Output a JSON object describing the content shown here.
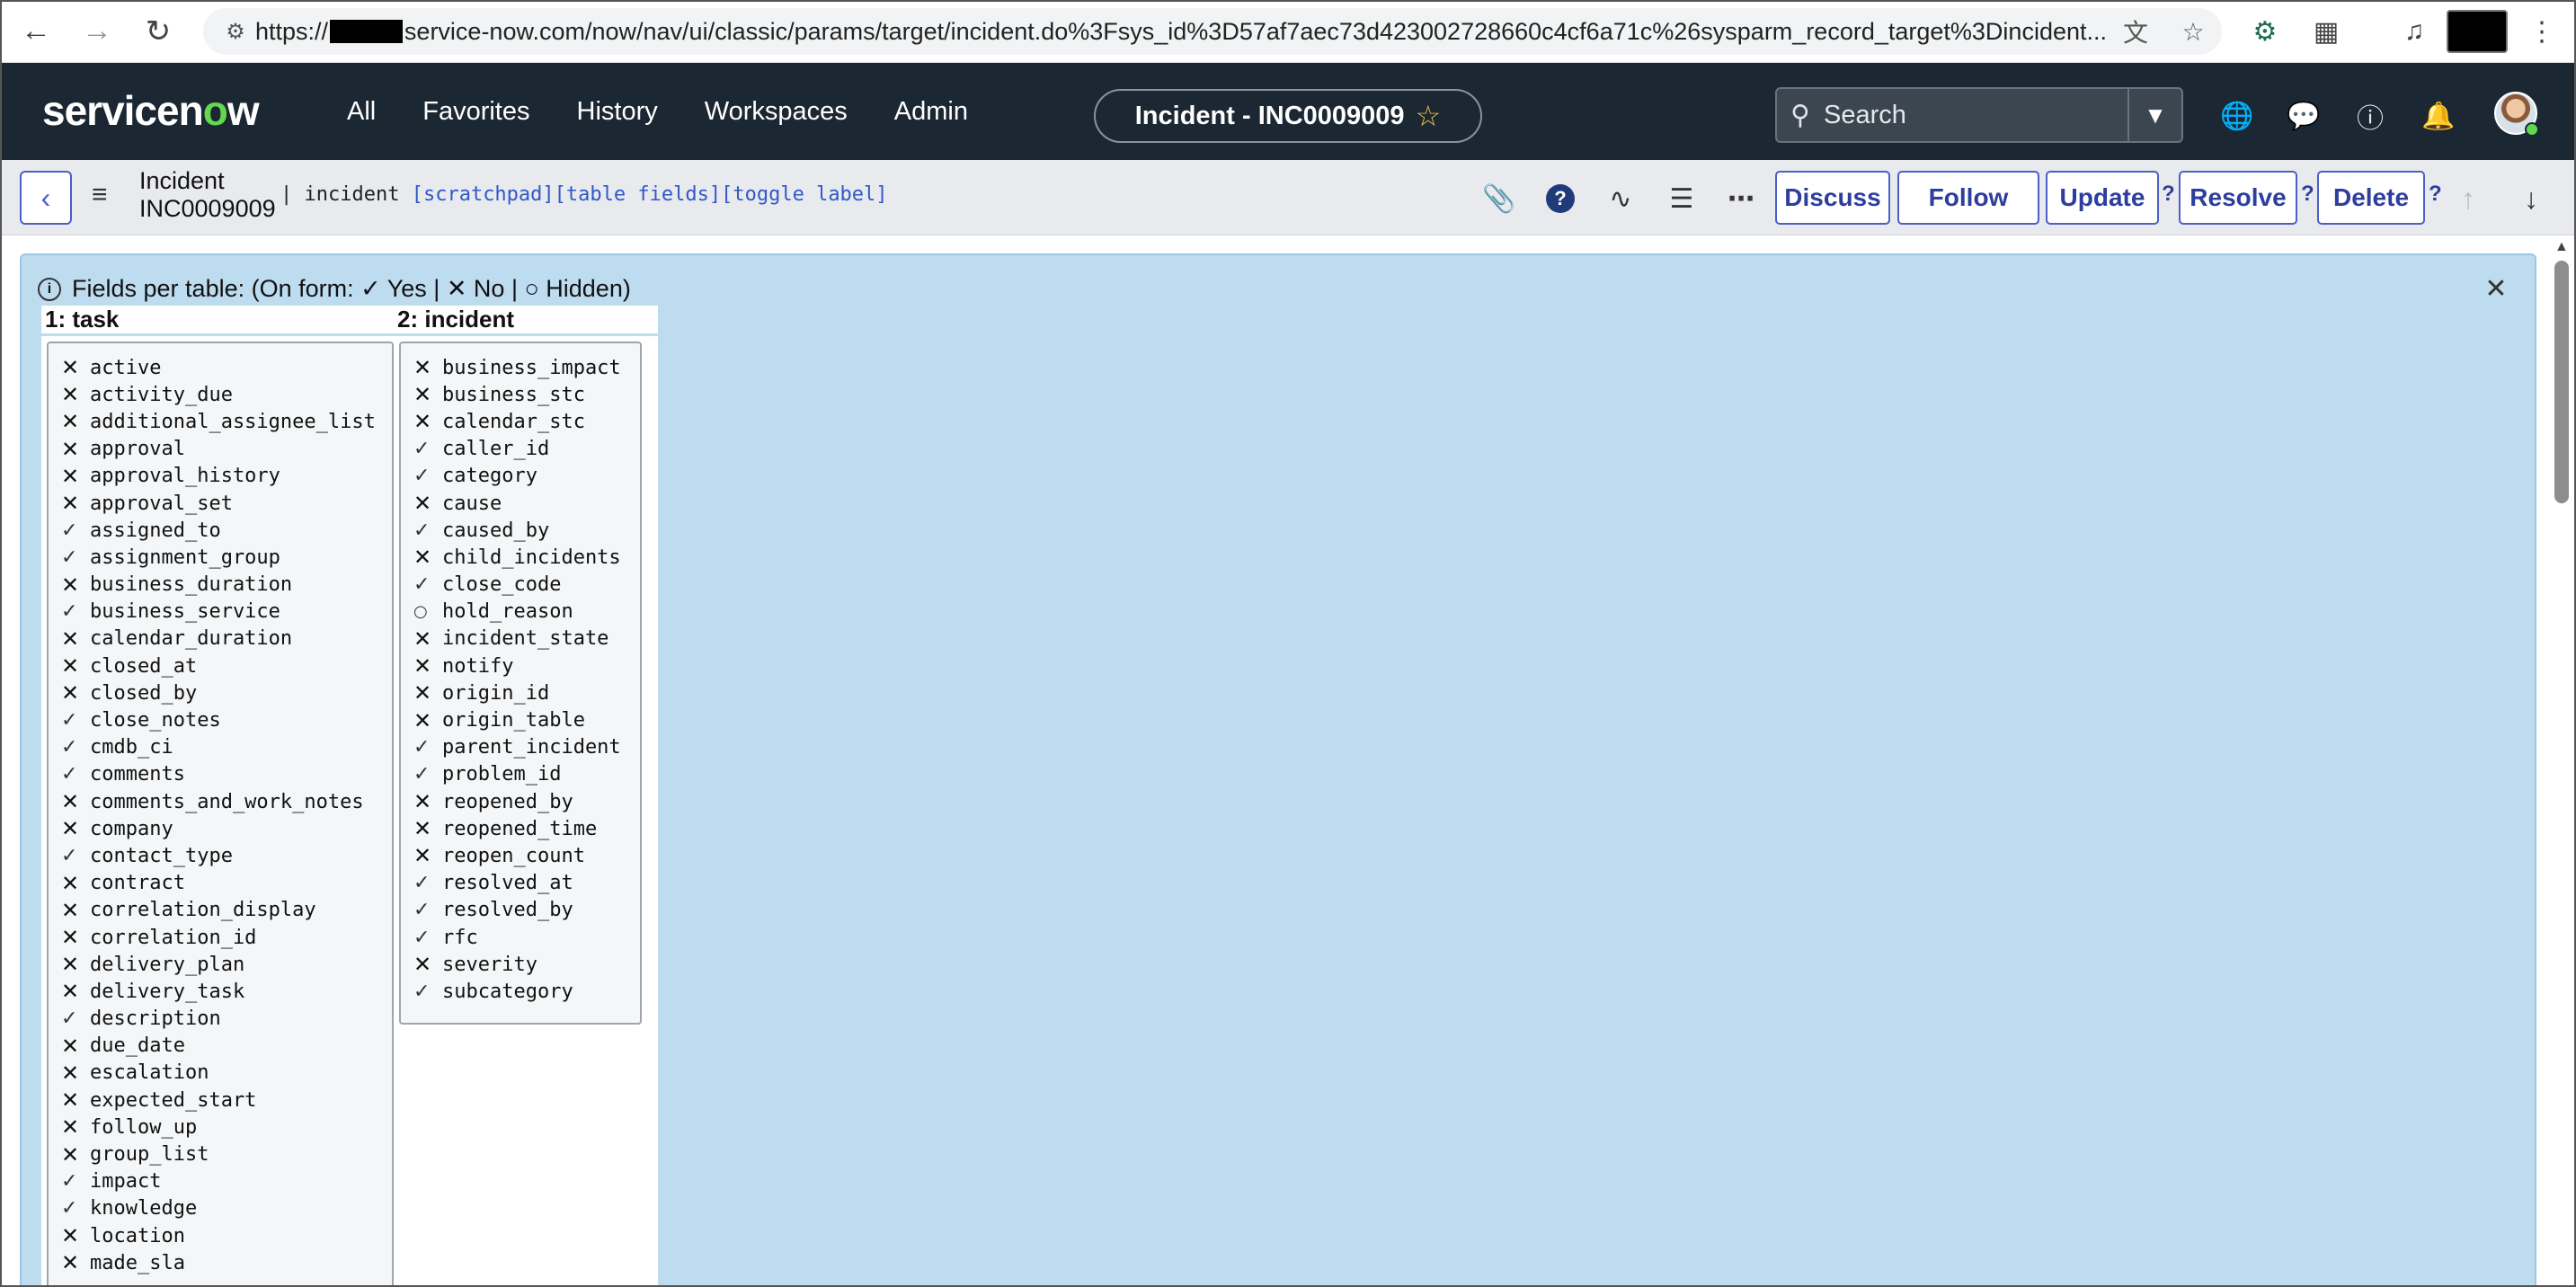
{
  "browser": {
    "url_prefix": "https://",
    "url_suffix": "service-now.com/now/nav/ui/classic/params/target/incident.do%3Fsys_id%3D57af7aec73d423002728660c4cf6a71c%26sysparm_record_target%3Dincident...",
    "icons": [
      "back-icon",
      "forward-icon",
      "reload-icon",
      "site-settings-icon",
      "translate-icon",
      "bookmark-star-icon",
      "extension-gear-icon",
      "extensions-puzzle-icon",
      "media-icon",
      "menu-dots-icon"
    ]
  },
  "header": {
    "logo_pre": "servicen",
    "logo_o": "o",
    "logo_post": "w",
    "nav": [
      "All",
      "Favorites",
      "History",
      "Workspaces",
      "Admin"
    ],
    "record_pill": "Incident - INC0009009",
    "search_placeholder": "Search",
    "accent": "#62d84e"
  },
  "form": {
    "table_label": "Incident",
    "number": "INC0009009",
    "separator": "|",
    "table_name": "incident",
    "links": [
      "[scratchpad]",
      "[table fields]",
      "[toggle label]"
    ],
    "buttons": [
      "Discuss",
      "Follow",
      "Update",
      "Resolve",
      "Delete"
    ],
    "help_marker": "?"
  },
  "panel": {
    "info_text": "Fields per table: (On form: ✓ Yes | ✕ No | ○ Hidden)",
    "yes_symbol": "✓",
    "no_symbol": "✕",
    "hidden_symbol": "○",
    "tables": [
      {
        "title": "1: task",
        "fields": [
          {
            "name": "active",
            "state": "no"
          },
          {
            "name": "activity_due",
            "state": "no"
          },
          {
            "name": "additional_assignee_list",
            "state": "no"
          },
          {
            "name": "approval",
            "state": "no"
          },
          {
            "name": "approval_history",
            "state": "no"
          },
          {
            "name": "approval_set",
            "state": "no"
          },
          {
            "name": "assigned_to",
            "state": "yes"
          },
          {
            "name": "assignment_group",
            "state": "yes"
          },
          {
            "name": "business_duration",
            "state": "no"
          },
          {
            "name": "business_service",
            "state": "yes"
          },
          {
            "name": "calendar_duration",
            "state": "no"
          },
          {
            "name": "closed_at",
            "state": "no"
          },
          {
            "name": "closed_by",
            "state": "no"
          },
          {
            "name": "close_notes",
            "state": "yes"
          },
          {
            "name": "cmdb_ci",
            "state": "yes"
          },
          {
            "name": "comments",
            "state": "yes"
          },
          {
            "name": "comments_and_work_notes",
            "state": "no"
          },
          {
            "name": "company",
            "state": "no"
          },
          {
            "name": "contact_type",
            "state": "yes"
          },
          {
            "name": "contract",
            "state": "no"
          },
          {
            "name": "correlation_display",
            "state": "no"
          },
          {
            "name": "correlation_id",
            "state": "no"
          },
          {
            "name": "delivery_plan",
            "state": "no"
          },
          {
            "name": "delivery_task",
            "state": "no"
          },
          {
            "name": "description",
            "state": "yes"
          },
          {
            "name": "due_date",
            "state": "no"
          },
          {
            "name": "escalation",
            "state": "no"
          },
          {
            "name": "expected_start",
            "state": "no"
          },
          {
            "name": "follow_up",
            "state": "no"
          },
          {
            "name": "group_list",
            "state": "no"
          },
          {
            "name": "impact",
            "state": "yes"
          },
          {
            "name": "knowledge",
            "state": "yes"
          },
          {
            "name": "location",
            "state": "no"
          },
          {
            "name": "made_sla",
            "state": "no"
          }
        ]
      },
      {
        "title": "2: incident",
        "fields": [
          {
            "name": "business_impact",
            "state": "no"
          },
          {
            "name": "business_stc",
            "state": "no"
          },
          {
            "name": "calendar_stc",
            "state": "no"
          },
          {
            "name": "caller_id",
            "state": "yes"
          },
          {
            "name": "category",
            "state": "yes"
          },
          {
            "name": "cause",
            "state": "no"
          },
          {
            "name": "caused_by",
            "state": "yes"
          },
          {
            "name": "child_incidents",
            "state": "no"
          },
          {
            "name": "close_code",
            "state": "yes"
          },
          {
            "name": "hold_reason",
            "state": "hidden"
          },
          {
            "name": "incident_state",
            "state": "no"
          },
          {
            "name": "notify",
            "state": "no"
          },
          {
            "name": "origin_id",
            "state": "no"
          },
          {
            "name": "origin_table",
            "state": "no"
          },
          {
            "name": "parent_incident",
            "state": "yes"
          },
          {
            "name": "problem_id",
            "state": "yes"
          },
          {
            "name": "reopened_by",
            "state": "no"
          },
          {
            "name": "reopened_time",
            "state": "no"
          },
          {
            "name": "reopen_count",
            "state": "no"
          },
          {
            "name": "resolved_at",
            "state": "yes"
          },
          {
            "name": "resolved_by",
            "state": "yes"
          },
          {
            "name": "rfc",
            "state": "yes"
          },
          {
            "name": "severity",
            "state": "no"
          },
          {
            "name": "subcategory",
            "state": "yes"
          }
        ]
      }
    ]
  }
}
